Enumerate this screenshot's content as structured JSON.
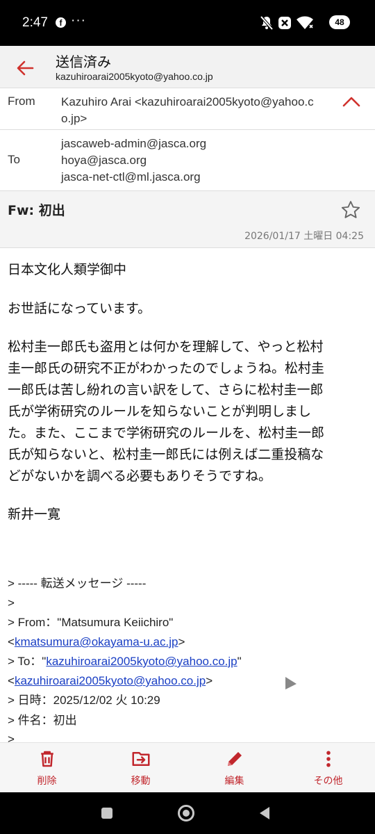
{
  "status_bar": {
    "time": "2:47",
    "app_icon": "f",
    "more": "···",
    "icons": [
      "mute-icon",
      "close-icon",
      "wifi-icon"
    ],
    "battery": "48"
  },
  "header": {
    "title": "送信済み",
    "account": "kazuhiroarai2005kyoto@yahoo.co.jp",
    "accent_color": "#d0322d"
  },
  "from": {
    "label": "From",
    "line1": "Kazuhiro Arai <kazuhiroarai2005kyoto@yahoo.c",
    "line2": "o.jp>"
  },
  "to": {
    "label": "To",
    "recipients": [
      "jascaweb-admin@jasca.org",
      "hoya@jasca.org",
      "jasca-net-ctl@ml.jasca.org"
    ]
  },
  "subject": "Fw: 初出",
  "date": "2026/01/17 土曜日 04:25",
  "body": {
    "greeting": "日本文化人類学御中",
    "intro": "お世話になっています。",
    "para_lines": [
      "松村圭一郎氏も盗用とは何かを理解して、やっと松村",
      "圭一郎氏の研究不正がわかったのでしょうね。松村圭",
      "一郎氏は苦し紛れの言い訳をして、さらに松村圭一郎",
      "氏が学術研究のルールを知らないことが判明しまし",
      "た。また、ここまで学術研究のルールを、松村圭一郎",
      "氏が知らないと、松村圭一郎氏には例えば二重投稿な",
      "どがないかを調べる必要もありそうですね。"
    ],
    "signature": "新井一寛"
  },
  "forwarded": {
    "header": "> ----- 転送メッセージ -----",
    "blank1": ">",
    "from_prefix": "> From：\"Matsumura Keiichiro\"",
    "from_open": "<",
    "from_email": "kmatsumura@okayama-u.ac.jp",
    "from_close": ">",
    "to_prefix": "> To：\"",
    "to_email": "kazuhiroarai2005kyoto@yahoo.co.jp",
    "to_quote": "\"",
    "to_open": "<",
    "to_email2": "kazuhiroarai2005kyoto@yahoo.co.jp",
    "to_close": ">",
    "date_line": "> 日時：2025/12/02 火 10:29",
    "subject_line": "> 件名：初出",
    "blank2": ">"
  },
  "toolbar": {
    "delete": "削除",
    "move": "移動",
    "edit": "編集",
    "more": "その他"
  }
}
